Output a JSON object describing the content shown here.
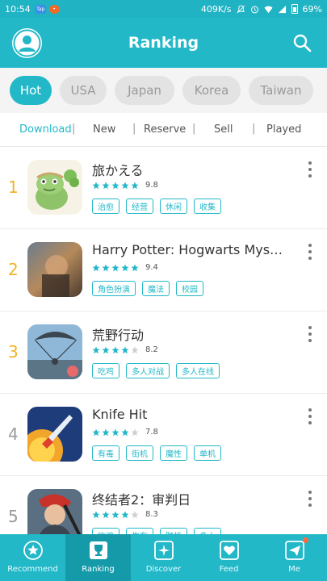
{
  "status_bar": {
    "time": "10:54",
    "network_speed": "409K/s",
    "battery": "69%"
  },
  "header": {
    "title": "Ranking"
  },
  "region_tabs": [
    "Hot",
    "USA",
    "Japan",
    "Korea",
    "Taiwan"
  ],
  "sub_tabs": [
    "Download",
    "New",
    "Reserve",
    "Sell",
    "Played"
  ],
  "apps": [
    {
      "rank": "1",
      "name": "旅かえる",
      "stars": 5,
      "score": "9.8",
      "tags": [
        "治愈",
        "经营",
        "休闲",
        "收集"
      ]
    },
    {
      "rank": "2",
      "name": "Harry Potter: Hogwarts Mys…",
      "stars": 5,
      "score": "9.4",
      "tags": [
        "角色扮演",
        "魔法",
        "校园"
      ]
    },
    {
      "rank": "3",
      "name": "荒野行动",
      "stars": 4,
      "score": "8.2",
      "tags": [
        "吃鸡",
        "多人对战",
        "多人在线"
      ]
    },
    {
      "rank": "4",
      "name": "Knife Hit",
      "stars": 4,
      "score": "7.8",
      "tags": [
        "有毒",
        "街机",
        "魔性",
        "单机"
      ]
    },
    {
      "rank": "5",
      "name": "终结者2：审判日",
      "stars": 4,
      "score": "8.3",
      "tags": [
        "吃鸡",
        "生存",
        "联机",
        "多人"
      ]
    }
  ],
  "bottom_nav": [
    "Recommend",
    "Ranking",
    "Discover",
    "Feed",
    "Me"
  ],
  "colors": {
    "accent": "#22b8c8",
    "rank_top": "#f0b429",
    "rank_other": "#9a9a9a",
    "notification_dot": "#ff6a3d"
  }
}
